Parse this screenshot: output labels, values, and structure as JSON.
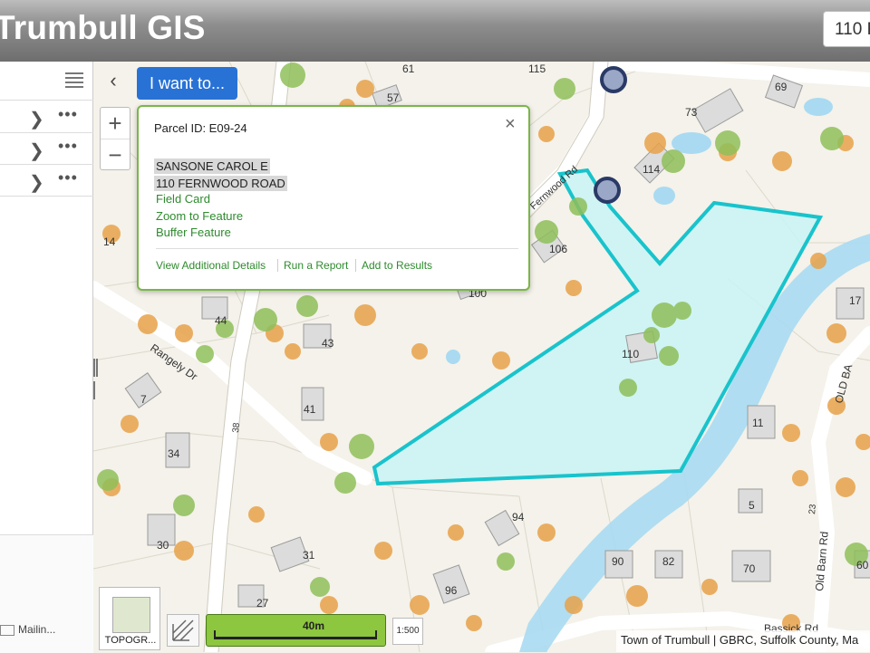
{
  "header": {
    "title": "Trumbull GIS",
    "search_value": "110 F"
  },
  "sidebar": {
    "rows": [
      {
        "chevron": "❯",
        "more": "•••"
      },
      {
        "chevron": "❯",
        "more": "•••"
      },
      {
        "chevron": "❯",
        "more": "•••"
      }
    ],
    "bottom_item": "Mailin..."
  },
  "toolbar": {
    "collapse": "‹",
    "iwant": "I want to...",
    "zoom_in": "+",
    "zoom_out": "−"
  },
  "popup": {
    "parcel_id": "Parcel ID: E09-24",
    "owner": "SANSONE CAROL E",
    "address": "110 FERNWOOD ROAD",
    "links": [
      "Field Card",
      "Zoom to Feature",
      "Buffer Feature"
    ],
    "bottom_links": [
      "View Additional Details",
      "Run a Report",
      "Add to Results"
    ],
    "close": "×"
  },
  "map": {
    "streets": [
      "Fernwood Rd",
      "Rangely Dr",
      "OLD BA",
      "Old Barn Rd",
      "Bassick Rd"
    ],
    "house_numbers": [
      "61",
      "115",
      "57",
      "69",
      "73",
      "114",
      "14",
      "106",
      "100",
      "44",
      "43",
      "110",
      "7",
      "41",
      "34",
      "17",
      "11",
      "30",
      "31",
      "94",
      "5",
      "90",
      "82",
      "70",
      "27",
      "96",
      "38",
      "23",
      "60"
    ],
    "parcel_color": "#19c3cc",
    "parcel_fill": "#c8f4f4",
    "marker_color": "#2a3a66"
  },
  "bottom": {
    "basemap_label": "TOPOGR...",
    "scale_label": "40m",
    "scale_ratio": "1:500",
    "attribution": "Town of Trumbull | GBRC, Suffolk County, Ma"
  }
}
